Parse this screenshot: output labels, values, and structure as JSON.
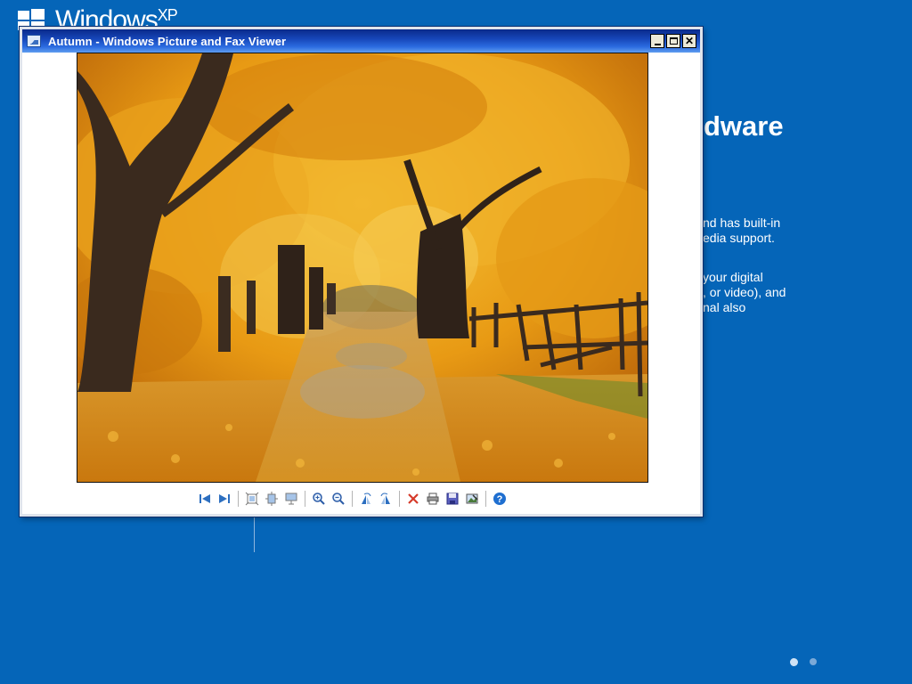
{
  "background": {
    "logo_text": "Windows",
    "logo_sup": "XP",
    "heading_fragment": "dware",
    "paragraph1": [
      "nd has built-in",
      "edia support."
    ],
    "paragraph2": [
      "your digital",
      ", or video), and",
      "nal also"
    ]
  },
  "window": {
    "title": "Autumn - Windows Picture and Fax Viewer",
    "controls": [
      "minimize",
      "maximize",
      "close"
    ],
    "close_glyph": "✕",
    "image_alt": "Autumn"
  },
  "toolbar": {
    "buttons": [
      {
        "name": "previous-image",
        "icon": "prev-icon"
      },
      {
        "name": "next-image",
        "icon": "next-icon"
      },
      {
        "name": "best-fit",
        "icon": "best-fit-icon"
      },
      {
        "name": "actual-size",
        "icon": "actual-size-icon"
      },
      {
        "name": "slide-show",
        "icon": "slideshow-icon"
      },
      {
        "name": "zoom-in",
        "icon": "zoom-in-icon"
      },
      {
        "name": "zoom-out",
        "icon": "zoom-out-icon"
      },
      {
        "name": "rotate-clockwise",
        "icon": "rotate-cw-icon"
      },
      {
        "name": "rotate-counterclockwise",
        "icon": "rotate-ccw-icon"
      },
      {
        "name": "delete",
        "icon": "delete-icon"
      },
      {
        "name": "print",
        "icon": "print-icon"
      },
      {
        "name": "copy-to",
        "icon": "save-icon"
      },
      {
        "name": "open-for-editing",
        "icon": "edit-icon"
      },
      {
        "name": "help",
        "icon": "help-icon"
      }
    ]
  },
  "colors": {
    "desktop_bg": "#0565b8",
    "title_gradient_start": "#0a2a8a",
    "title_gradient_end": "#5f9df0",
    "foliage": "#e8a21a"
  },
  "pagination_dots": 2
}
